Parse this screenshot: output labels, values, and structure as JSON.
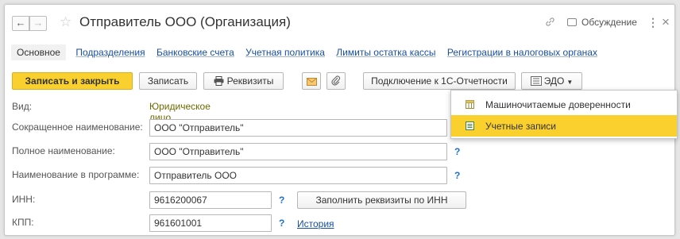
{
  "window": {
    "title": "Отправитель ООО (Организация)",
    "nav_back": "←",
    "nav_forward": "→",
    "star": "☆",
    "link_symbol": "🔗",
    "discussion": "Обсуждение",
    "more": "⋮",
    "close": "×"
  },
  "tabs": [
    {
      "label": "Основное",
      "active": true
    },
    {
      "label": "Подразделения"
    },
    {
      "label": "Банковские счета"
    },
    {
      "label": "Учетная политика"
    },
    {
      "label": "Лимиты остатка кассы"
    },
    {
      "label": "Регистрации в налоговых органах"
    }
  ],
  "toolbar": {
    "save_close": "Записать и закрыть",
    "save": "Записать",
    "requisites": "Реквизиты",
    "connect": "Подключение к 1С-Отчетности",
    "edo": "ЭДО"
  },
  "form": {
    "vid_label": "Вид:",
    "vid_value": "Юридическое лицо",
    "short_label": "Сокращенное наименование:",
    "short_value": "ООО \"Отправитель\"",
    "full_label": "Полное наименование:",
    "full_value": "ООО \"Отправитель\"",
    "prog_label": "Наименование в программе:",
    "prog_value": "Отправитель ООО",
    "inn_label": "ИНН:",
    "inn_value": "9616200067",
    "fill_button": "Заполнить реквизиты по ИНН",
    "kpp_label": "КПП:",
    "kpp_value": "961601001",
    "history_link": "История",
    "help": "?"
  },
  "dropdown": {
    "items": [
      {
        "label": "Машиночитаемые доверенности",
        "icon": "table-icon"
      },
      {
        "label": "Учетные записи",
        "icon": "document-icon",
        "selected": true
      }
    ]
  },
  "colors": {
    "accent": "#fad02f",
    "link": "#1a4fa0",
    "help": "#1a6fd0"
  }
}
